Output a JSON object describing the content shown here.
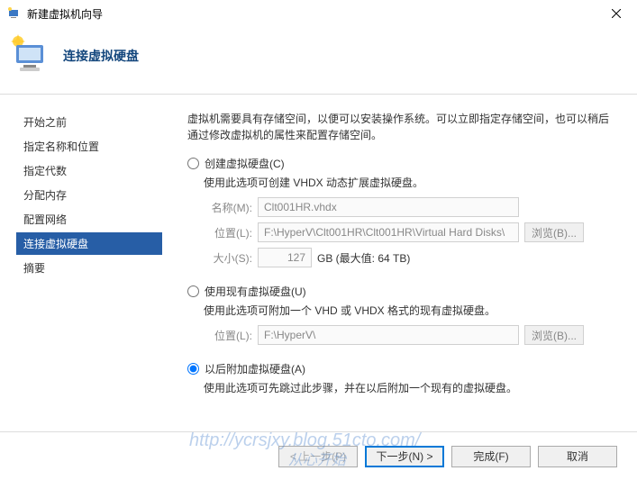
{
  "window": {
    "title": "新建虚拟机向导"
  },
  "header": {
    "title": "连接虚拟硬盘"
  },
  "sidebar": {
    "items": [
      {
        "label": "开始之前"
      },
      {
        "label": "指定名称和位置"
      },
      {
        "label": "指定代数"
      },
      {
        "label": "分配内存"
      },
      {
        "label": "配置网络"
      },
      {
        "label": "连接虚拟硬盘",
        "active": true
      },
      {
        "label": "摘要"
      }
    ]
  },
  "content": {
    "description": "虚拟机需要具有存储空间，以便可以安装操作系统。可以立即指定存储空间，也可以稍后通过修改虚拟机的属性来配置存储空间。",
    "option_create": {
      "label": "创建虚拟硬盘(C)",
      "desc": "使用此选项可创建 VHDX 动态扩展虚拟硬盘。",
      "name_label": "名称(M):",
      "name_value": "Clt001HR.vhdx",
      "location_label": "位置(L):",
      "location_value": "F:\\HyperV\\Clt001HR\\Clt001HR\\Virtual Hard Disks\\",
      "browse_label": "浏览(B)...",
      "size_label": "大小(S):",
      "size_value": "127",
      "size_suffix": "GB (最大值: 64 TB)"
    },
    "option_existing": {
      "label": "使用现有虚拟硬盘(U)",
      "desc": "使用此选项可附加一个 VHD 或 VHDX 格式的现有虚拟硬盘。",
      "location_label": "位置(L):",
      "location_value": "F:\\HyperV\\",
      "browse_label": "浏览(B)..."
    },
    "option_later": {
      "label": "以后附加虚拟硬盘(A)",
      "desc": "使用此选项可先跳过此步骤，并在以后附加一个现有的虚拟硬盘。"
    }
  },
  "footer": {
    "prev": "< 上一步(P)",
    "next": "下一步(N) >",
    "finish": "完成(F)",
    "cancel": "取消"
  },
  "watermark": {
    "url": "http://ycrsjxy.blog.51cto.com/",
    "sub": "从心开始"
  }
}
